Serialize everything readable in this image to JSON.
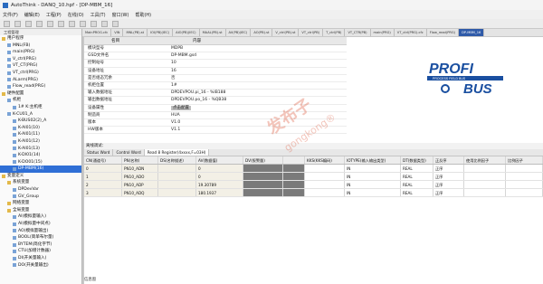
{
  "window": {
    "title": "AutoThink - DANQ_10.hpf - [DP-MBM_16]"
  },
  "menu": [
    "文件(F)",
    "编辑(E)",
    "工程(P)",
    "在线(O)",
    "工具(T)",
    "窗口(W)",
    "帮助(H)"
  ],
  "tabs": [
    {
      "label": "MainPROG.cfc"
    },
    {
      "label": "VIN"
    },
    {
      "label": "MNL(PB).st"
    },
    {
      "label": "IOI(PB)(IEC)"
    },
    {
      "label": "AIO(PB)(IEC)"
    },
    {
      "label": "MAAL(PB).st"
    },
    {
      "label": "AV(PB)(IEC)"
    },
    {
      "label": "AO(PB).st"
    },
    {
      "label": "V_ctrl(PB).st"
    },
    {
      "label": "VT_ctrl(PB)"
    },
    {
      "label": "T_ctrl(PB)"
    },
    {
      "label": "VT_CTR(PB)"
    },
    {
      "label": "main(PRG)"
    },
    {
      "label": "VT_ctrl(PRG).cfc"
    },
    {
      "label": "Flow_read(PRG)"
    },
    {
      "label": "DP-MBM_16",
      "active": true
    }
  ],
  "sidebar": {
    "title": "工程管理",
    "items": [
      {
        "label": "用户程序",
        "folder": true
      },
      {
        "label": "MNL(FB)"
      },
      {
        "label": "main(PRG)"
      },
      {
        "label": "V_ctrl(PRG)"
      },
      {
        "label": "VT_CT(PRG)"
      },
      {
        "label": "VT_ctrl(PRG)"
      },
      {
        "label": "ALarm(PRG)"
      },
      {
        "label": "Flow_read(PRG)"
      },
      {
        "label": "硬件配置",
        "folder": true
      },
      {
        "label": "机柜"
      },
      {
        "label": "1# K:主机柜"
      },
      {
        "label": "K-CU01_A"
      },
      {
        "label": "K-BUS02(2)_A"
      },
      {
        "label": "K-AI01(10)"
      },
      {
        "label": "K-AI01(11)"
      },
      {
        "label": "K-AI01(12)"
      },
      {
        "label": "K-AI01(13)"
      },
      {
        "label": "K-DI01(14)"
      },
      {
        "label": "K-DO01(15)"
      },
      {
        "label": "DP-MBM(16)",
        "selected": true
      },
      {
        "label": "变量定义",
        "folder": true
      },
      {
        "label": "系统变量",
        "folder": true
      },
      {
        "label": "DPDevVar"
      },
      {
        "label": "GV_Group"
      },
      {
        "label": "网络变量",
        "folder": true
      },
      {
        "label": "全局变量",
        "folder": true
      },
      {
        "label": "AI(模拟量输入)"
      },
      {
        "label": "AI(模拟量中间点)"
      },
      {
        "label": "AO(模拟量输出)"
      },
      {
        "label": "BOOL(简单布尔量)"
      },
      {
        "label": "BYTEM(简化字节)"
      },
      {
        "label": "CTU(加增计数器)"
      },
      {
        "label": "DI(开关量输入)"
      },
      {
        "label": "DO(开关量输出)"
      }
    ]
  },
  "properties": {
    "col_name": "名目",
    "col_content": "内容",
    "rows": [
      {
        "key": "模块型号",
        "value": "MDPB"
      },
      {
        "key": "GSD文件名",
        "value": "DP-MBM.gsd"
      },
      {
        "key": "控制站号",
        "value": "10"
      },
      {
        "key": "设备地址",
        "value": "16"
      },
      {
        "key": "是否组态冗余",
        "value": "否"
      },
      {
        "key": "机柜位置",
        "value": "1#"
      },
      {
        "key": "输入数据地址",
        "value": "DPDEVPOU.pi_16 - %IB188"
      },
      {
        "key": "输出数据地址",
        "value": "DPDEVPOU.po_16 - %QB38"
      },
      {
        "key": "设备属性",
        "value": "点击配置",
        "highlight": true
      },
      {
        "key": "制造商",
        "value": "HUA"
      },
      {
        "key": "版本",
        "value": "V1.0"
      },
      {
        "key": "HW版本",
        "value": "V1.1"
      }
    ]
  },
  "watermark": {
    "main": "发布子",
    "sub": "gongkong®"
  },
  "lower": {
    "label": "离线调试：",
    "subtabs": [
      "Status Word",
      "Control Word",
      "Read 8 Register(4xxxx,F=03H)"
    ],
    "columns": {
      "cn": "CN(通道号)",
      "pn": "PN(名称)",
      "ds": "DS(名称描述)",
      "av": "AV(数据值)",
      "dv": "DV(报警量)",
      "blank": "",
      "kks": "KKS(KKS编码)",
      "io": "IOTYPE(输入输出类型)",
      "dt": "DT(数据类型)",
      "pos": "正反序",
      "scale": "使用比例因子",
      "ratio": "比例因子"
    },
    "rows": [
      {
        "cn": "0",
        "pn": "PN10_ADN",
        "ds": "",
        "av": "0",
        "dv": "",
        "kks": "",
        "io": "IN",
        "dt": "REAL",
        "pos": "正序",
        "scale": "",
        "ratio": ""
      },
      {
        "cn": "1",
        "pn": "PN10_ADO",
        "ds": "",
        "av": "0",
        "dv": "",
        "kks": "",
        "io": "IN",
        "dt": "REAL",
        "pos": "正序",
        "scale": "",
        "ratio": ""
      },
      {
        "cn": "2",
        "pn": "PN10_ADP",
        "ds": "",
        "av": "19.30789",
        "dv": "",
        "kks": "",
        "io": "IN",
        "dt": "REAL",
        "pos": "正序",
        "scale": "",
        "ratio": ""
      },
      {
        "cn": "3",
        "pn": "PN10_ADQ",
        "ds": "",
        "av": "180.1937",
        "dv": "",
        "kks": "",
        "io": "IN",
        "dt": "REAL",
        "pos": "正序",
        "scale": "",
        "ratio": ""
      }
    ]
  },
  "status": {
    "text": "信息窗"
  },
  "logo": {
    "line1": "PROFI",
    "line2": "PROCESS FIELD BUS",
    "line3": "BUS"
  }
}
